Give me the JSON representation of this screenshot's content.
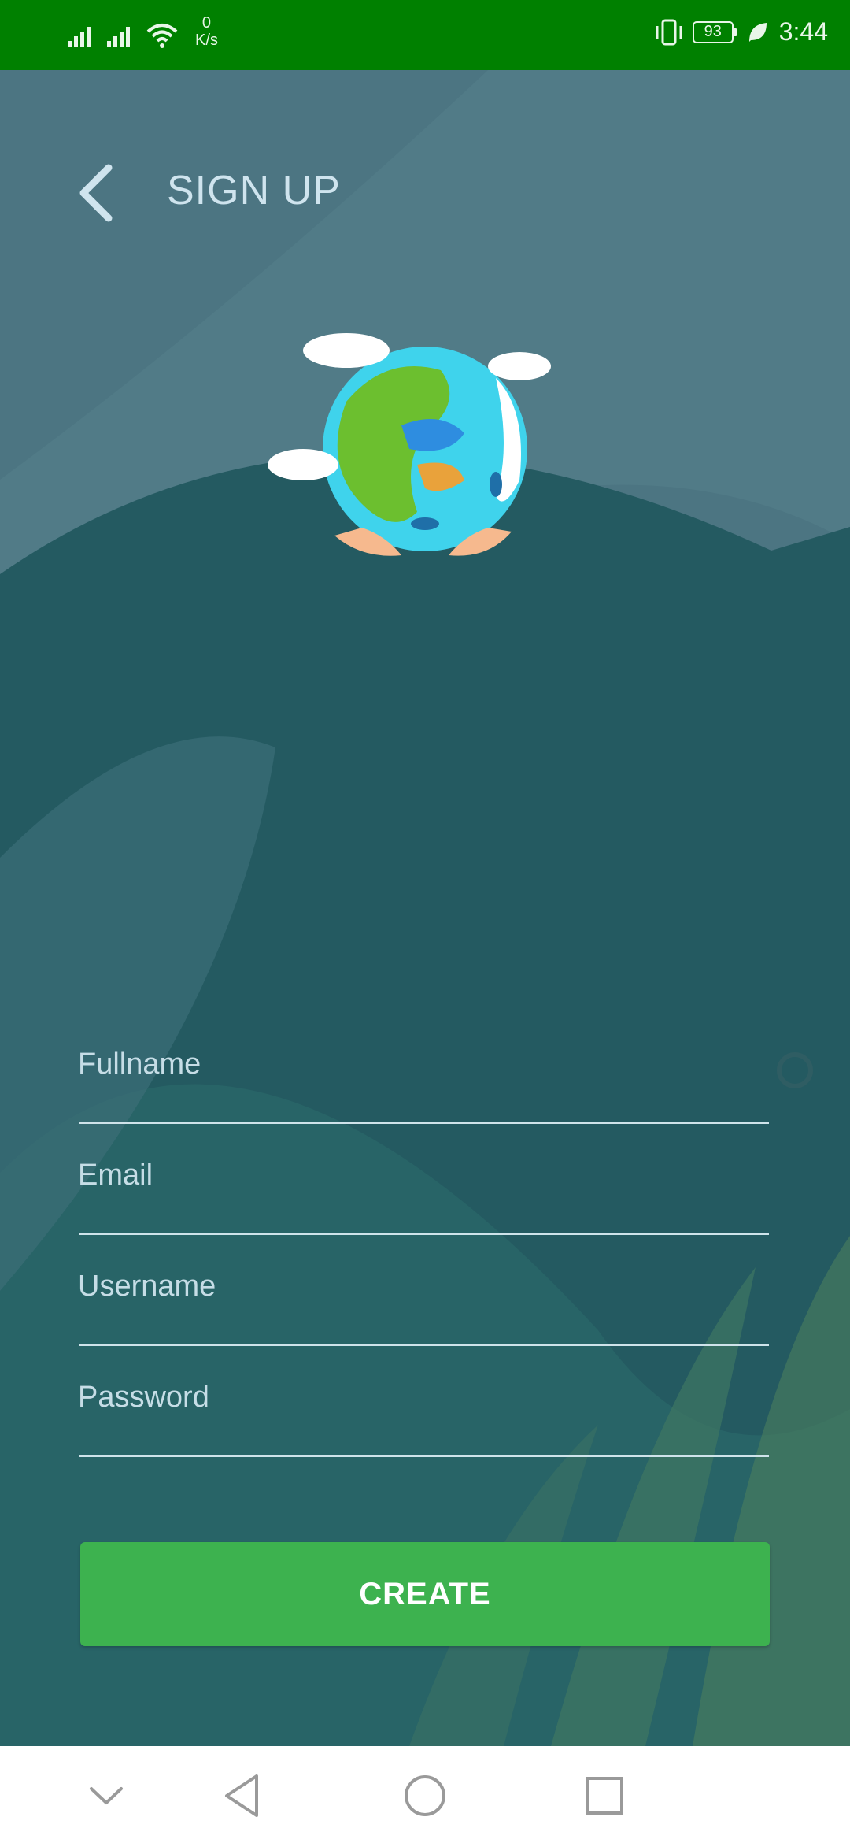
{
  "status_bar": {
    "net_speed_value": "0",
    "net_speed_unit": "K/s",
    "battery": "93",
    "time": "3:44",
    "icons": [
      "signal-icon",
      "signal-icon",
      "wifi-icon",
      "vibrate-icon",
      "battery-icon",
      "leaf-icon"
    ]
  },
  "header": {
    "title": "SIGN UP",
    "back_icon": "chevron-left-icon"
  },
  "form": {
    "fullname_placeholder": "Fullname",
    "email_placeholder": "Email",
    "username_placeholder": "Username",
    "password_placeholder": "Password",
    "create_label": "CREATE"
  },
  "nav_bar": {
    "icons": [
      "chevron-down-icon",
      "back-triangle-icon",
      "home-circle-icon",
      "recents-square-icon"
    ]
  },
  "colors": {
    "status_bar": "#008000",
    "background": "#3f6a74",
    "button": "#3db24f"
  }
}
